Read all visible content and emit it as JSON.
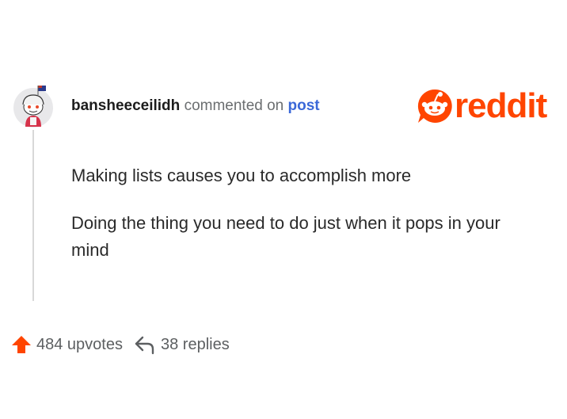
{
  "comment": {
    "username": "bansheeceilidh",
    "action_text": "commented on",
    "target_link": "post",
    "paragraphs": [
      "Making lists causes you to accomplish more",
      "Doing the thing you need to do just when it pops in your mind"
    ]
  },
  "footer": {
    "upvotes_label": "484 upvotes",
    "replies_label": "38 replies"
  },
  "brand": {
    "logo_text": "reddit",
    "color": "#ff4500",
    "link_color": "#3a68d8"
  },
  "icons": {
    "upvote": "upvote-arrow-icon",
    "reply": "reply-arrow-icon",
    "logo": "reddit-snoo-icon"
  }
}
